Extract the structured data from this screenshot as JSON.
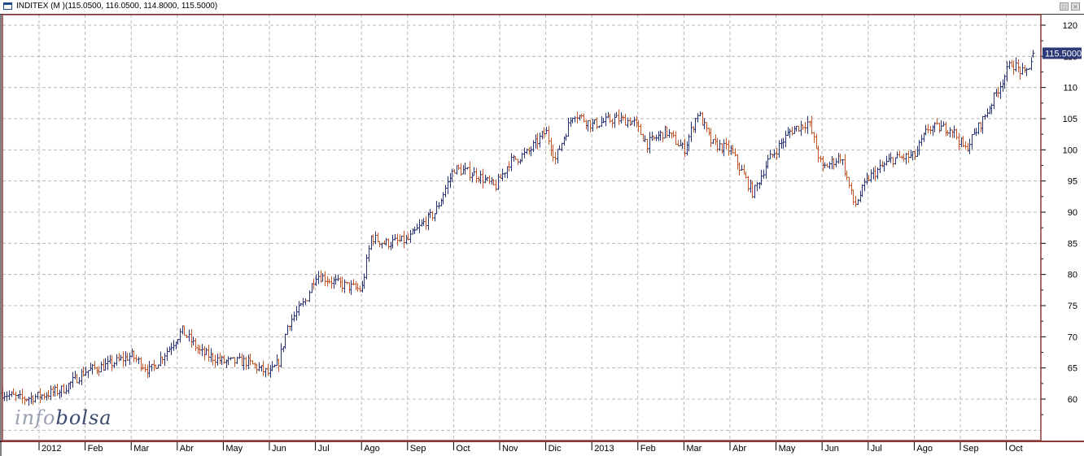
{
  "window": {
    "title": "INDITEX (M )(115.0500, 116.0500, 114.8000, 115.5000)",
    "restore_label": "□",
    "close_label": "×"
  },
  "logo": {
    "part1": "info",
    "part2": "bolsa"
  },
  "colors": {
    "up": "#2a3470",
    "down": "#c0562a",
    "grid": "#b8b8b8",
    "frame": "#8b3a3a",
    "price_box": "#2e3a78"
  },
  "chart_data": {
    "type": "ohlc",
    "title": "INDITEX (M )",
    "last": {
      "open": 115.05,
      "high": 116.05,
      "low": 114.8,
      "close": 115.5,
      "label": "115.5000"
    },
    "ylim": [
      55,
      122
    ],
    "yticks": [
      "120",
      "115",
      "110",
      "105",
      "100",
      "95",
      "90",
      "85",
      "80",
      "75",
      "70",
      "65",
      "60"
    ],
    "ytick_values": [
      120,
      115,
      110,
      105,
      100,
      95,
      90,
      85,
      80,
      75,
      70,
      65,
      60
    ],
    "xticks": [
      "2012",
      "Feb",
      "Mar",
      "Abr",
      "May",
      "Jun",
      "Jul",
      "Ago",
      "Sep",
      "Oct",
      "Nov",
      "Dic",
      "2013",
      "Feb",
      "Mar",
      "Abr",
      "May",
      "Jun",
      "Jul",
      "Ago",
      "Sep",
      "Oct"
    ],
    "xunit": "months since Jan 2012",
    "xlim": [
      -0.8,
      21.6
    ],
    "approx_close_path": [
      [
        -0.8,
        61
      ],
      [
        -0.4,
        60
      ],
      [
        0,
        60.5
      ],
      [
        0.5,
        61.5
      ],
      [
        1,
        64.5
      ],
      [
        1.5,
        65.5
      ],
      [
        2,
        67
      ],
      [
        2.4,
        64.5
      ],
      [
        2.8,
        68
      ],
      [
        3.1,
        71
      ],
      [
        3.5,
        67.5
      ],
      [
        4,
        66
      ],
      [
        4.5,
        66
      ],
      [
        5,
        64
      ],
      [
        5.2,
        66
      ],
      [
        5.4,
        72
      ],
      [
        5.8,
        76
      ],
      [
        6,
        80
      ],
      [
        6.5,
        78.5
      ],
      [
        7,
        77.5
      ],
      [
        7.2,
        86
      ],
      [
        7.5,
        85
      ],
      [
        8,
        85.5
      ],
      [
        8.3,
        88
      ],
      [
        8.6,
        90
      ],
      [
        9,
        97
      ],
      [
        9.5,
        96
      ],
      [
        9.9,
        94
      ],
      [
        10.2,
        98
      ],
      [
        10.6,
        99.5
      ],
      [
        11,
        103
      ],
      [
        11.2,
        98.5
      ],
      [
        11.6,
        106
      ],
      [
        12,
        104
      ],
      [
        12.5,
        105
      ],
      [
        12.9,
        104.5
      ],
      [
        13.2,
        101
      ],
      [
        13.6,
        103
      ],
      [
        14,
        100
      ],
      [
        14.3,
        106
      ],
      [
        14.6,
        101
      ],
      [
        15,
        100
      ],
      [
        15.5,
        93
      ],
      [
        15.8,
        98
      ],
      [
        16.3,
        103
      ],
      [
        16.7,
        104.5
      ],
      [
        17,
        97
      ],
      [
        17.4,
        99
      ],
      [
        17.7,
        91
      ],
      [
        18,
        95.5
      ],
      [
        18.5,
        98.5
      ],
      [
        19,
        99
      ],
      [
        19.3,
        103.5
      ],
      [
        19.8,
        103.5
      ],
      [
        20.1,
        100
      ],
      [
        20.5,
        105
      ],
      [
        20.9,
        111
      ],
      [
        21.1,
        114
      ],
      [
        21.4,
        112
      ],
      [
        21.6,
        115.5
      ]
    ]
  }
}
